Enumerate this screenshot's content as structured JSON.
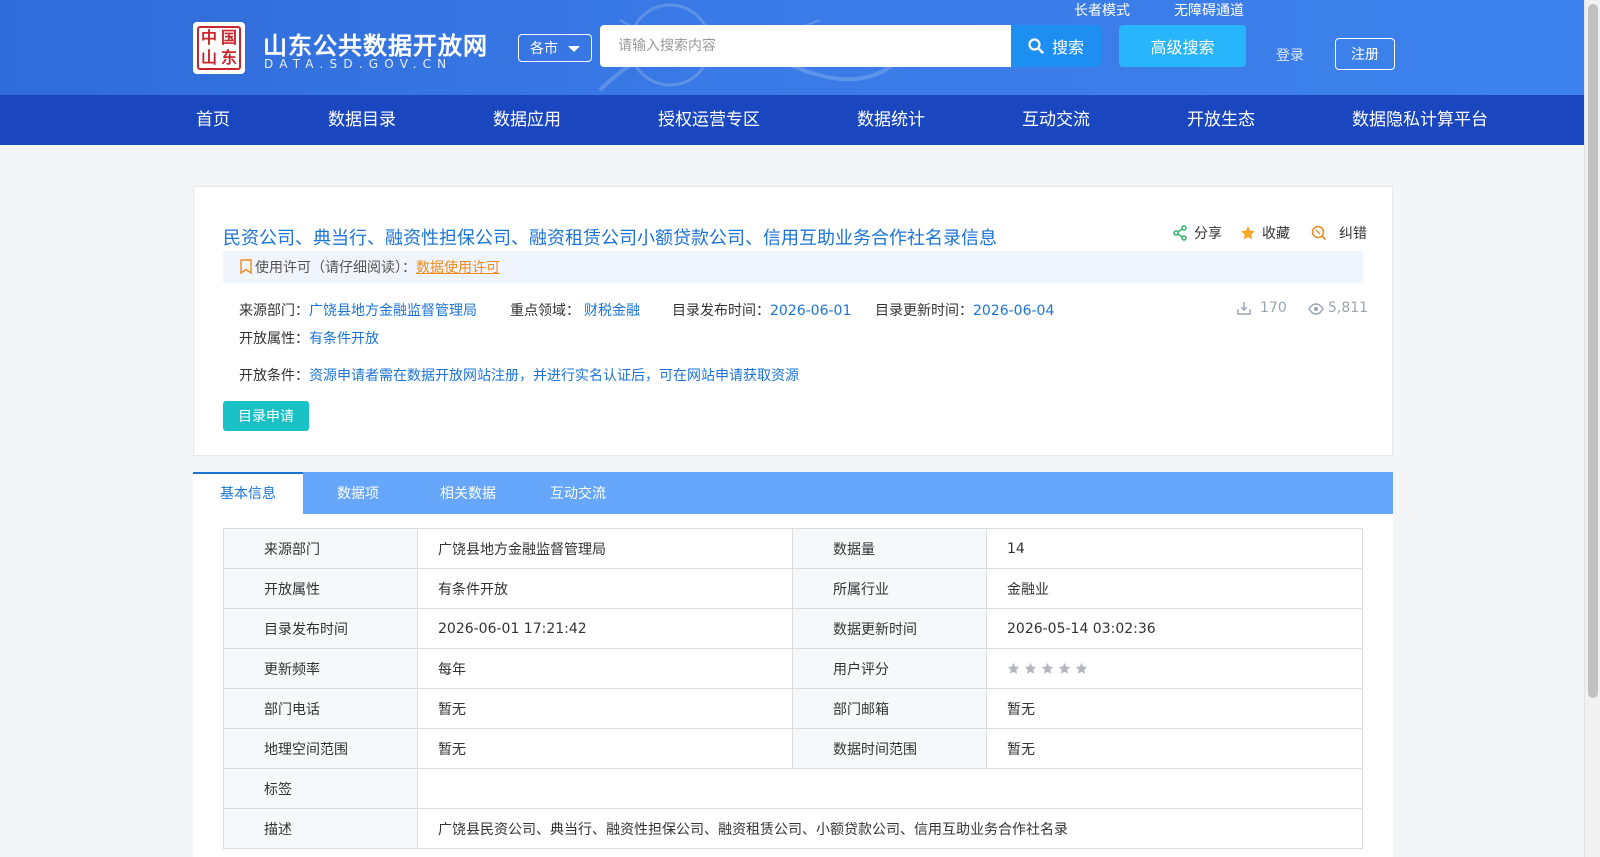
{
  "header": {
    "logo_seal_chars": [
      "中",
      "国",
      "山",
      "东"
    ],
    "site_title": "山东公共数据开放网",
    "site_domain": "DATA.SD.GOV.CN",
    "elder_mode": "长者模式",
    "accessibility": "无障碍通道",
    "city_select": "各市",
    "search_placeholder": "请输入搜索内容",
    "search_button": "搜索",
    "advanced_search": "高级搜索",
    "login": "登录",
    "register": "注册"
  },
  "nav": {
    "items": [
      "首页",
      "数据目录",
      "数据应用",
      "授权运营专区",
      "数据统计",
      "互动交流",
      "开放生态",
      "数据隐私计算平台"
    ]
  },
  "dataset": {
    "title": "民资公司、典当行、融资性担保公司、融资租赁公司小额贷款公司、信用互助业务合作社名录信息",
    "actions": {
      "share": "分享",
      "favorite": "收藏",
      "correct": "纠错"
    },
    "license_label": "使用许可（请仔细阅读）：",
    "license_link": "数据使用许可",
    "source_label": "来源部门：",
    "source_value": "广饶县地方金融监督管理局",
    "domain_label": "重点领域：",
    "domain_value": "财税金融",
    "publish_label": "目录发布时间：",
    "publish_value": "2026-06-01",
    "update_label": "目录更新时间：",
    "update_value": "2026-06-04",
    "downloads": "170",
    "views": "5,811",
    "open_attr_label": "开放属性：",
    "open_attr_value": "有条件开放",
    "open_cond_label": "开放条件：",
    "open_cond_value": "资源申请者需在数据开放网站注册，并进行实名认证后，可在网站申请获取资源",
    "apply_button": "目录申请"
  },
  "tabs": [
    "基本信息",
    "数据项",
    "相关数据",
    "互动交流"
  ],
  "info_table": {
    "rows": [
      {
        "k1": "来源部门",
        "v1": "广饶县地方金融监督管理局",
        "k2": "数据量",
        "v2": "14"
      },
      {
        "k1": "开放属性",
        "v1": "有条件开放",
        "k2": "所属行业",
        "v2": "金融业"
      },
      {
        "k1": "目录发布时间",
        "v1": "2026-06-01 17:21:42",
        "k2": "数据更新时间",
        "v2": "2026-05-14 03:02:36"
      },
      {
        "k1": "更新频率",
        "v1": "每年",
        "k2": "用户评分",
        "v2": ""
      },
      {
        "k1": "部门电话",
        "v1": "暂无",
        "k2": "部门邮箱",
        "v2": "暂无"
      },
      {
        "k1": "地理空间范围",
        "v1": "暂无",
        "k2": "数据时间范围",
        "v2": "暂无"
      }
    ],
    "tags_label": "标签",
    "tags_value": "",
    "desc_label": "描述",
    "desc_value": "广饶县民资公司、典当行、融资性担保公司、融资租赁公司、小额贷款公司、信用互助业务合作社名录",
    "rating_stars": 0,
    "rating_max": 5
  },
  "colors": {
    "header_bg": "#3a7ae6",
    "nav_bg": "#1a47c0",
    "link_blue": "#1a74d8",
    "license_orange": "#f08a1c",
    "apply_teal": "#19c0c4",
    "tab_bar": "#66a6fb"
  }
}
